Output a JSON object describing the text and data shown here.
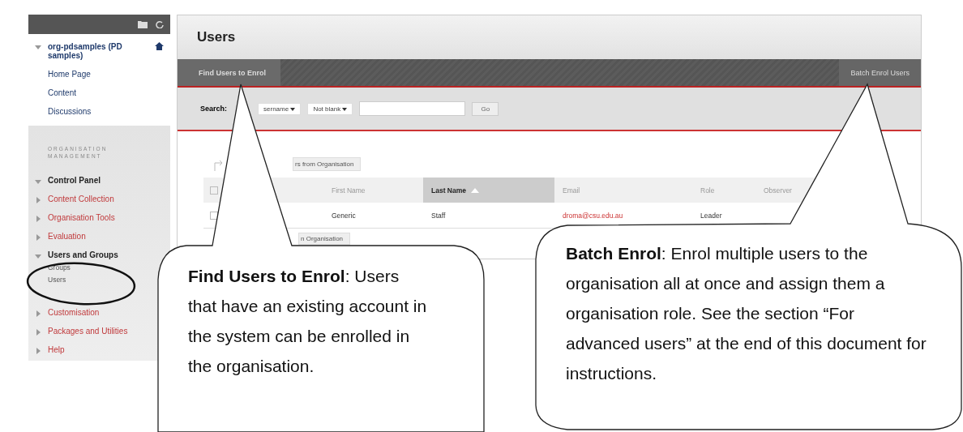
{
  "sidebar": {
    "course": {
      "title": "org-pdsamples (PD samples)",
      "expanded": true,
      "links": [
        "Home Page",
        "Content",
        "Discussions"
      ]
    },
    "section_label": "ORGANISATION MANAGEMENT",
    "control_panel": {
      "label": "Control Panel",
      "expanded": true
    },
    "items": [
      {
        "label": "Content Collection",
        "expanded": false
      },
      {
        "label": "Organisation Tools",
        "expanded": false
      },
      {
        "label": "Evaluation",
        "expanded": false
      },
      {
        "label": "Users and Groups",
        "expanded": true,
        "children": [
          "Groups",
          "Users"
        ]
      },
      {
        "label": "Customisation",
        "expanded": false
      },
      {
        "label": "Packages and Utilities",
        "expanded": false
      },
      {
        "label": "Help",
        "expanded": false
      }
    ]
  },
  "page": {
    "title": "Users",
    "tabs": [
      {
        "label": "Find Users to Enrol",
        "selected": true
      }
    ],
    "action": "Batch Enrol Users",
    "search": {
      "label": "Search:",
      "field": "sername",
      "operator": "Not blank",
      "go": "Go"
    },
    "table": {
      "top_button": "rs from Organisation",
      "select_all": {
        "checked": false
      },
      "columns": [
        {
          "label": "First Name",
          "sorted": false
        },
        {
          "label": "Last Name",
          "sorted": true
        },
        {
          "label": "Email",
          "sorted": false
        },
        {
          "label": "Role",
          "sorted": false
        },
        {
          "label": "Observer",
          "sorted": false
        }
      ],
      "rows": [
        {
          "checked": false,
          "first": "Generic",
          "last": "Staff",
          "email": "droma@csu.edu.au",
          "role": "Leader"
        }
      ],
      "bottom_button": "n Organisation"
    }
  },
  "callouts": [
    {
      "text": "**Find Users to Enrol**: Users that have an existing account in the system can be enrolled in the organisation."
    },
    {
      "text": "**Batch Enrol**: Enrol multiple users to the organisation all at once and assign them a organisation role. See the section “For advanced users” at the end of this document for instructions."
    }
  ]
}
